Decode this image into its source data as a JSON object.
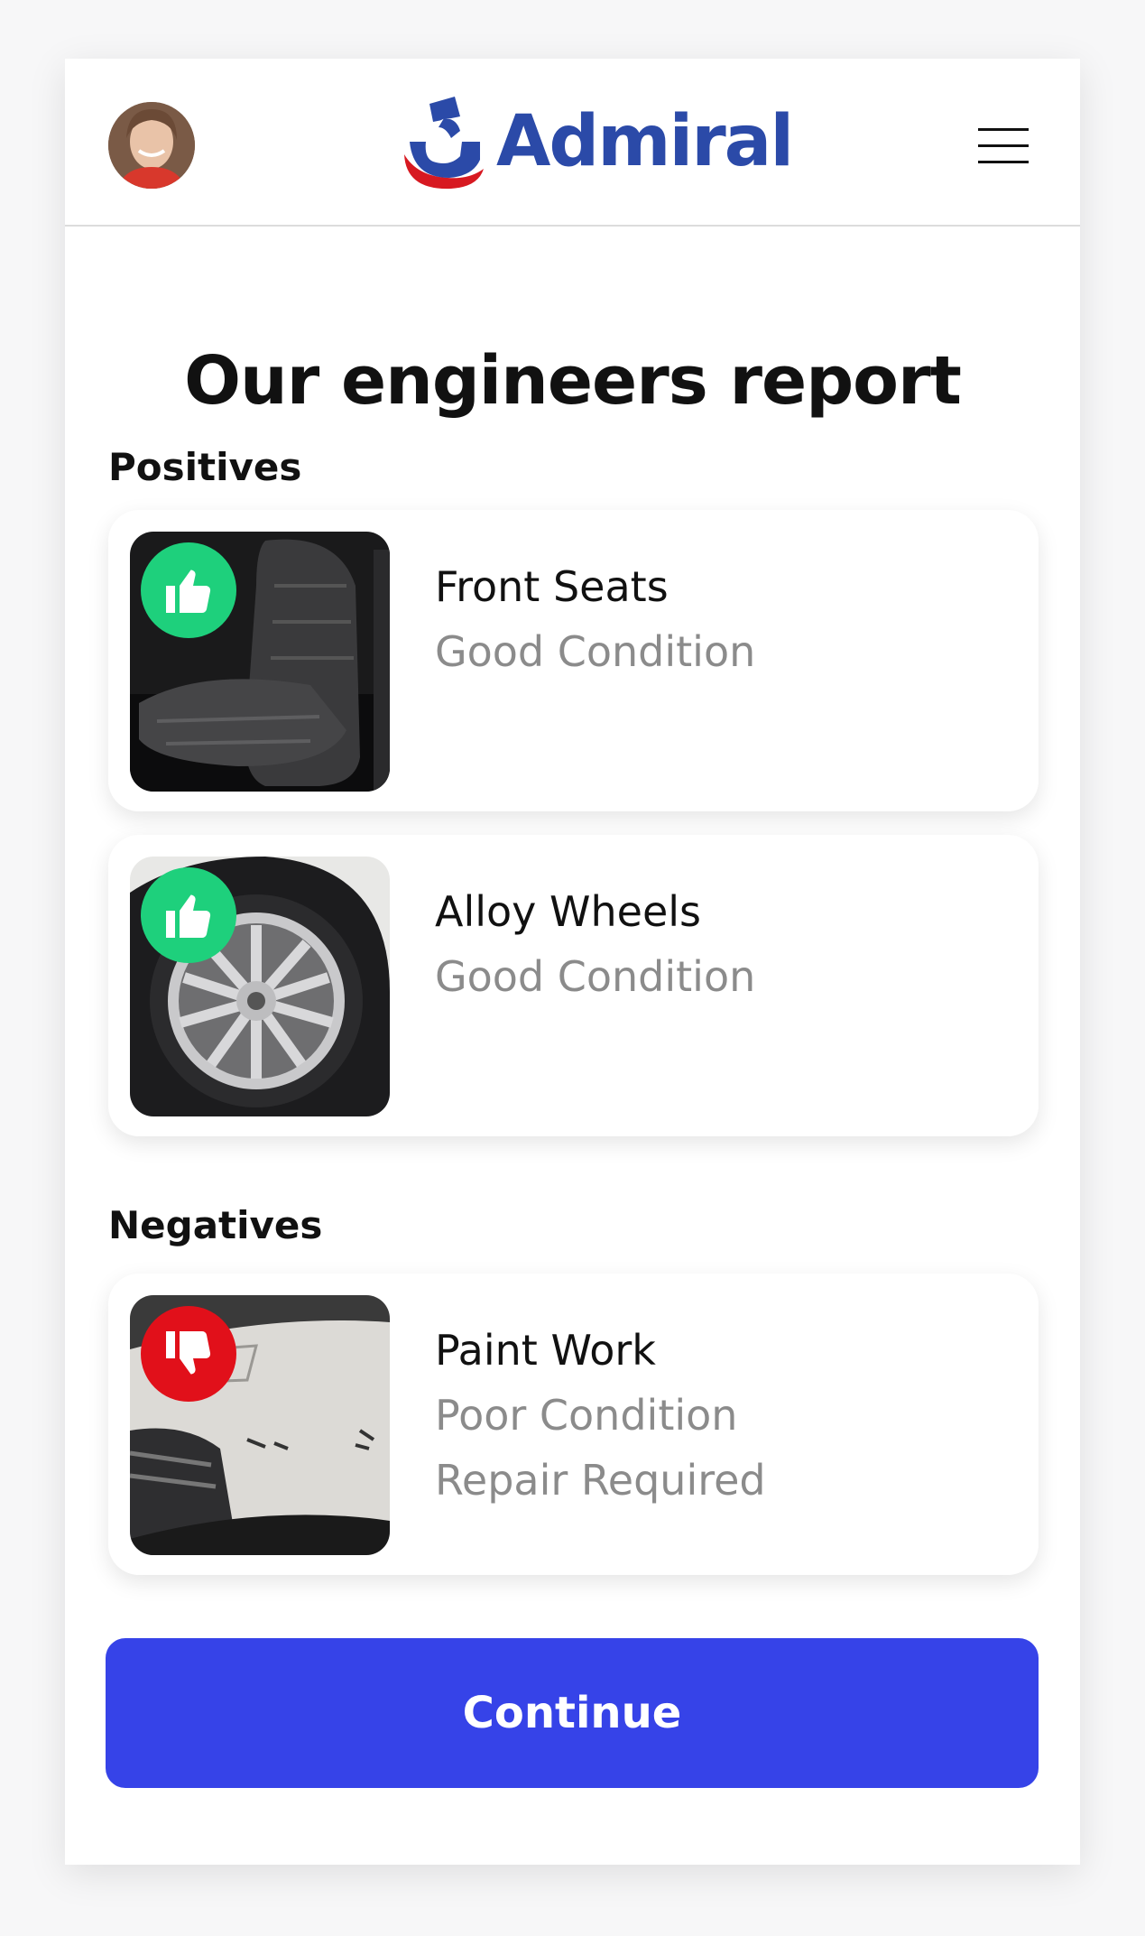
{
  "header": {
    "brand": "Admiral",
    "avatar_icon": "user-avatar",
    "menu_icon": "hamburger-menu-icon"
  },
  "page_title": "Our engineers report",
  "positives": {
    "label": "Positives",
    "items": [
      {
        "title": "Front Seats",
        "lines": [
          "Good Condition"
        ],
        "icon": "thumbs-up-icon"
      },
      {
        "title": "Alloy Wheels",
        "lines": [
          "Good Condition"
        ],
        "icon": "thumbs-up-icon"
      }
    ]
  },
  "negatives": {
    "label": "Negatives",
    "items": [
      {
        "title": "Paint Work",
        "lines": [
          "Poor Condition",
          "Repair Required"
        ],
        "icon": "thumbs-down-icon"
      }
    ]
  },
  "continue_label": "Continue",
  "colors": {
    "positive": "#1ed07c",
    "negative": "#e1101a",
    "primary_button": "#3643e8",
    "brand_blue": "#2b4aa8"
  }
}
